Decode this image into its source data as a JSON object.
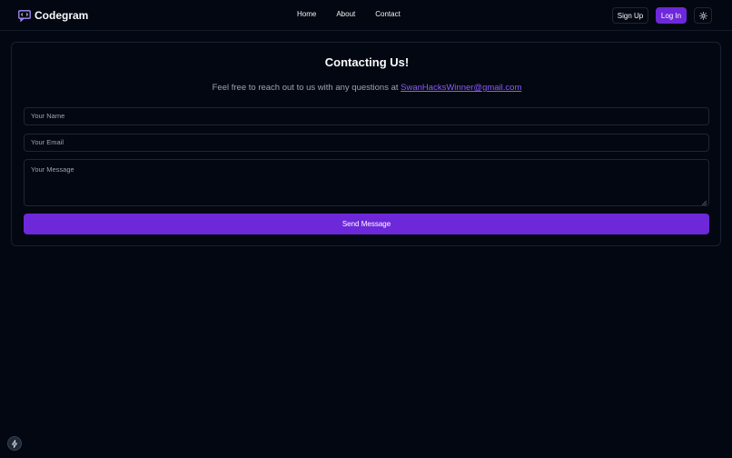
{
  "brand": {
    "name": "Codegram",
    "icon": "chat-code-icon"
  },
  "nav": {
    "links": [
      {
        "label": "Home"
      },
      {
        "label": "About"
      },
      {
        "label": "Contact"
      }
    ],
    "signup_label": "Sign Up",
    "login_label": "Log In",
    "theme_icon": "sun-icon"
  },
  "contact": {
    "title": "Contacting Us!",
    "intro": "Feel free to reach out to us with any questions at ",
    "email": "SwanHacksWinner@gmail.com",
    "name_placeholder": "Your Name",
    "email_placeholder": "Your Email",
    "message_placeholder": "Your Message",
    "send_label": "Send Message"
  },
  "colors": {
    "background": "#030712",
    "accent": "#6d28d9",
    "link": "#8b5cf6",
    "muted_text": "#9ca3af"
  },
  "floating_button": {
    "icon": "lightning-icon"
  }
}
